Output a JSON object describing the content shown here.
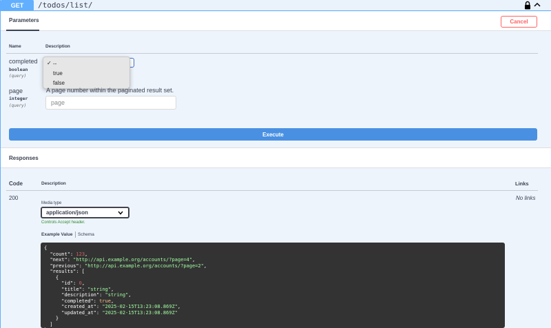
{
  "endpoint": {
    "method": "GET",
    "path": "/todos/list/"
  },
  "parameters": {
    "tab_label": "Parameters",
    "cancel_label": "Cancel",
    "col_name": "Name",
    "col_description": "Description",
    "items": [
      {
        "name": "completed",
        "type": "boolean",
        "location": "(query)",
        "dropdown_options": [
          "--",
          "true",
          "false"
        ],
        "selected": "--"
      },
      {
        "name": "page",
        "type": "integer",
        "location": "(query)",
        "description": "A page number within the paginated result set.",
        "placeholder": "page"
      }
    ],
    "execute_label": "Execute"
  },
  "responses": {
    "title": "Responses",
    "col_code": "Code",
    "col_description": "Description",
    "col_links": "Links",
    "row": {
      "code": "200",
      "links": "No links",
      "media_type_label": "Media type",
      "media_type": "application/json",
      "accept_note": "Controls Accept header.",
      "tab_example": "Example Value",
      "tab_schema": "Schema"
    },
    "example": {
      "count": "123",
      "next": "\"http://api.example.org/accounts/?page=4\"",
      "previous": "\"http://api.example.org/accounts/?page=2\"",
      "id": "0",
      "title": "\"string\"",
      "description": "\"string\"",
      "completed": "true",
      "created_at": "\"2025-02-15T13:23:08.869Z\"",
      "updated_at": "\"2025-02-15T13:23:08.869Z\""
    }
  },
  "colors": {
    "get_blue": "#61affe",
    "execute_blue": "#4990e2",
    "cancel_red": "#ff6060"
  },
  "icons": [
    "lock-icon",
    "chevron-up-icon",
    "chevron-down-icon",
    "check-icon"
  ]
}
